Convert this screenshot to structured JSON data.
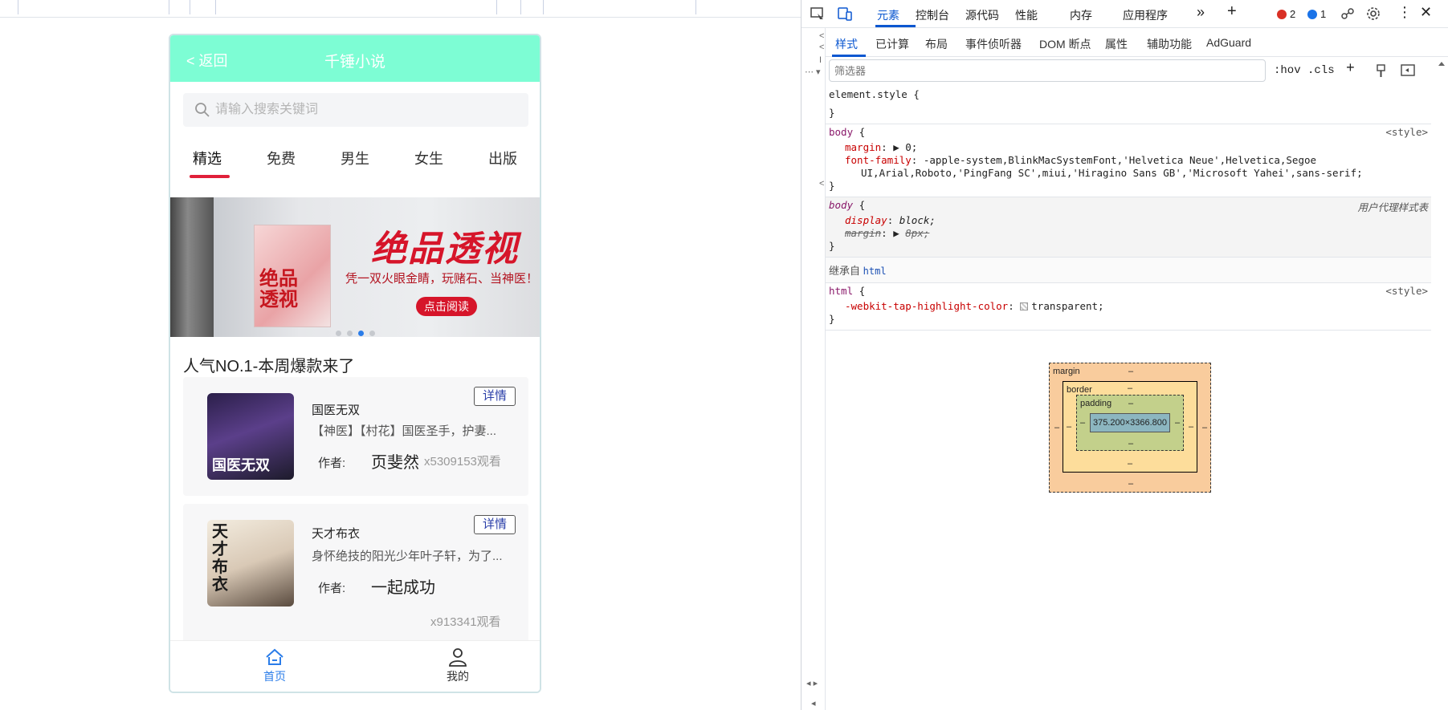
{
  "app": {
    "back_label": "< 返回",
    "title": "千锤小说",
    "search_placeholder": "请输入搜索关键词",
    "tabs": [
      "精选",
      "免费",
      "男生",
      "女生",
      "出版"
    ],
    "banner": {
      "book_cover_text": "绝品透视",
      "headline": "绝品透视",
      "subtitle": "凭一双火眼金睛，玩赌石、当神医！",
      "cta": "点击阅读"
    },
    "section_title": "人气NO.1-本周爆款来了",
    "books": [
      {
        "title": "国医无双",
        "cover_text": "国医无双",
        "desc": "【神医】【村花】国医圣手，护妻...",
        "author_label": "作者:",
        "author": "页斐然",
        "views": "x5309153观看",
        "detail": "详情"
      },
      {
        "title": "天才布衣",
        "cover_text": "天才布衣",
        "desc": "身怀绝技的阳光少年叶子轩，为了...",
        "author_label": "作者:",
        "author": "一起成功",
        "views": "x913341观看",
        "detail": "详情"
      }
    ],
    "bottom_nav": [
      {
        "label": "首页",
        "active": true,
        "icon": "home-icon"
      },
      {
        "label": "我的",
        "active": false,
        "icon": "user-icon"
      }
    ],
    "colors": {
      "navbar": "#7dfdd4",
      "tab_underline": "#e0203a",
      "active_nav": "#2b7de9"
    }
  },
  "devtools": {
    "main_tabs": [
      "元素",
      "控制台",
      "源代码",
      "性能",
      "内存",
      "应用程序"
    ],
    "error_count": "2",
    "info_count": "1",
    "sub_tabs": [
      "样式",
      "已计算",
      "布局",
      "事件侦听器",
      "DOM 断点",
      "属性",
      "辅助功能",
      "AdGuard"
    ],
    "filter_placeholder": "筛选器",
    "hov": ":hov",
    "cls": ".cls",
    "rules": {
      "element_style": "element.style {",
      "element_style_close": "}",
      "body1_selector": "body",
      "body1_source": "<style>",
      "margin_name": "margin",
      "margin_value": "0;",
      "font_family_name": "font-family",
      "font_family_value": "-apple-system,BlinkMacSystemFont,'Helvetica Neue',Helvetica,Segoe",
      "font_family_value2": "UI,Arial,Roboto,'PingFang SC',miui,'Hiragino Sans GB','Microsoft Yahei',sans-serif;",
      "body2_selector": "body",
      "body2_source": "用户代理样式表",
      "display_name": "display",
      "display_value": "block;",
      "margin2_name": "margin",
      "margin2_value": "8px;",
      "inherited_label": "继承自",
      "inherited_from": "html",
      "html_selector": "html",
      "html_source": "<style>",
      "tap_name": "-webkit-tap-highlight-color",
      "tap_value": "transparent;"
    },
    "box_model": {
      "margin": "margin",
      "border": "border",
      "padding": "padding",
      "content": "375.200×3366.800",
      "dash": "–"
    }
  }
}
